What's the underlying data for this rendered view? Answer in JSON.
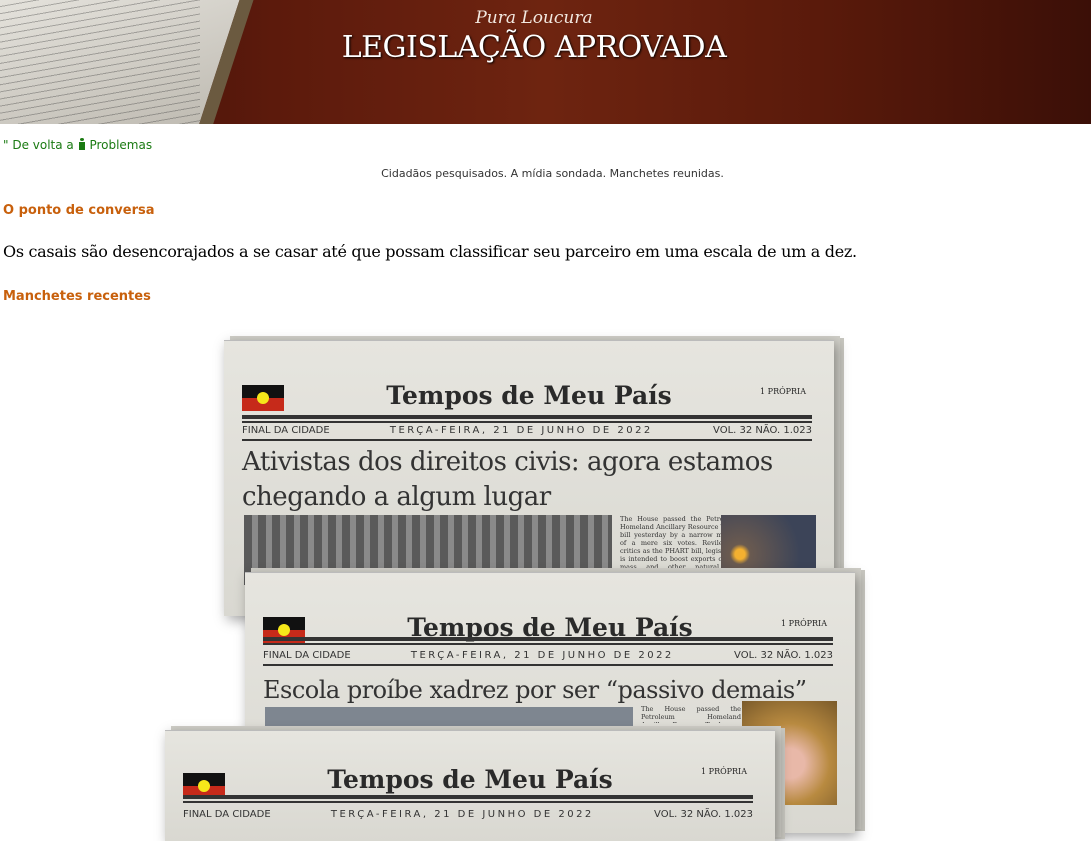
{
  "banner": {
    "kicker": "Pura Loucura",
    "title": "LEGISLAÇÃO APROVADA"
  },
  "nav": {
    "back_prefix": "\" De volta a",
    "back_icon": "person-icon",
    "back_link": "Problemas"
  },
  "tagline": "Cidadãos pesquisados. A mídia sondada. Manchetes reunidas.",
  "talking_point": {
    "heading": "O ponto de conversa",
    "text": "Os casais são desencorajados a se casar até que possam classificar seu parceiro em uma escala de um a dez."
  },
  "recent": {
    "heading": "Manchetes recentes"
  },
  "colors": {
    "link": "#1a7a12",
    "heading": "#c8600c"
  },
  "papers": [
    {
      "masthead": "Tempos de Meu País",
      "copy": "1 PRÓPRIA",
      "edition": "FINAL DA CIDADE",
      "date": "TERÇA-FEIRA, 21 DE JUNHO DE 2022",
      "volume": "VOL. 32 NÃO. 1.023",
      "headline": "Ativistas dos direitos civis: agora estamos chegando a algum lugar",
      "blurb": "The House passed the Petroleum Homeland Ancillary Resource Trade bill yesterday by a narrow margin of a mere six votes. Reviled by critics as the PHART bill, legislation is intended to boost exports of bio-mass and other natural gas technologies to"
    },
    {
      "masthead": "Tempos de Meu País",
      "copy": "1 PRÓPRIA",
      "edition": "FINAL DA CIDADE",
      "date": "TERÇA-FEIRA, 21 DE JUNHO DE 2022",
      "volume": "VOL. 32 NÃO. 1.023",
      "headline": "Escola proíbe xadrez por ser “passivo demais”",
      "blurb": "The House passed the Petroleum Homeland Ancillary Resource Trade"
    },
    {
      "masthead": "Tempos de Meu País",
      "copy": "1 PRÓPRIA",
      "edition": "FINAL DA CIDADE",
      "date": "TERÇA-FEIRA, 21 DE JUNHO DE 2022",
      "volume": "VOL. 32 NÃO. 1.023"
    }
  ]
}
